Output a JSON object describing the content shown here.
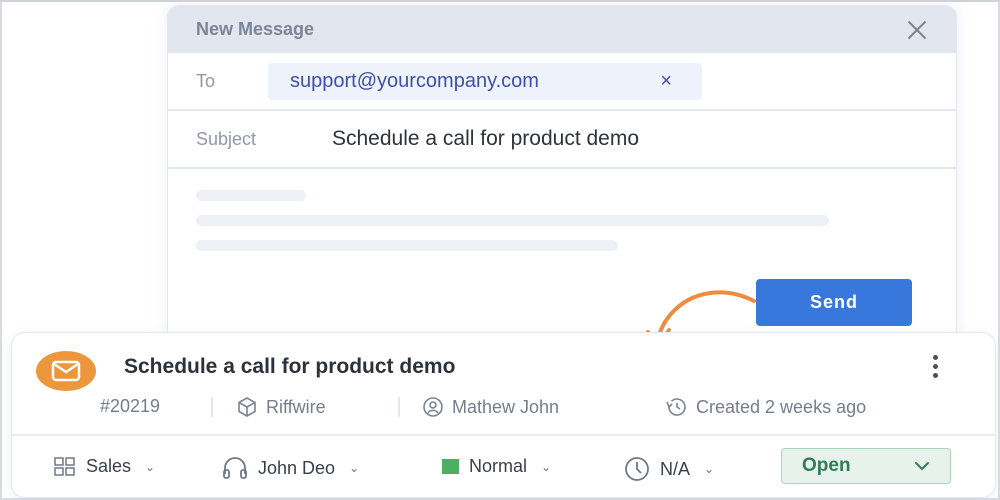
{
  "compose": {
    "title": "New Message",
    "to_label": "To",
    "to_value": "support@yourcompany.com",
    "remove_chip": "×",
    "subject_label": "Subject",
    "subject_value": "Schedule a call for product demo",
    "send_label": "Send"
  },
  "ticket": {
    "title": "Schedule a call for product demo",
    "id": "#20219",
    "company": "Riffwire",
    "contact": "Mathew John",
    "created": "Created 2 weeks ago",
    "group": "Sales",
    "agent": "John Deo",
    "priority": "Normal",
    "priority_color": "#4caf64",
    "due": "N/A",
    "status": "Open"
  },
  "colors": {
    "accent": "#3877db",
    "avatar": "#ec973b",
    "arrow": "#ef8a3e",
    "status_green": "#2e7d54"
  }
}
